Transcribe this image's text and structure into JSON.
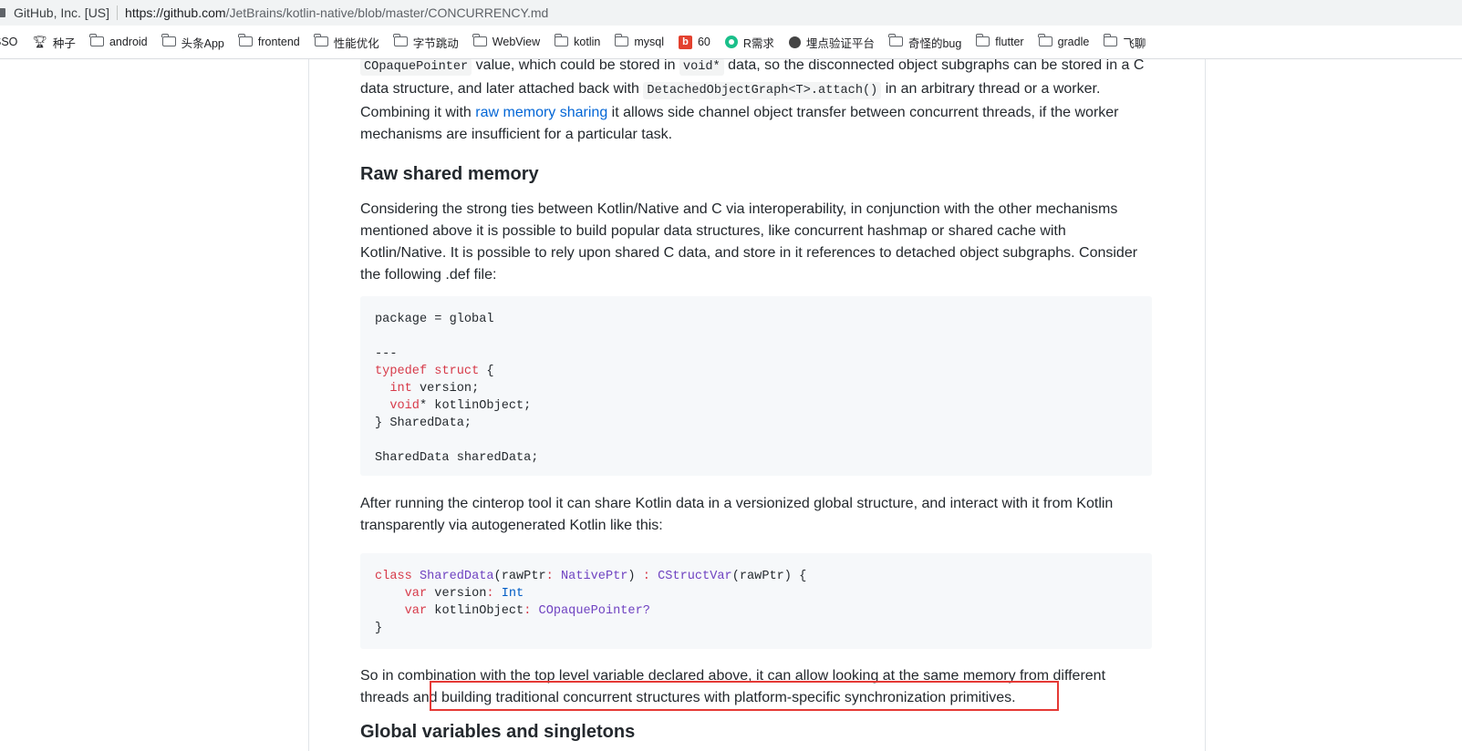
{
  "browser": {
    "site_label": "GitHub, Inc. [US]",
    "url_host": "https://github.com",
    "url_path": "/JetBrains/kotlin-native/blob/master/CONCURRENCY.md"
  },
  "bookmarks": [
    {
      "label": "SSO",
      "icon": "none"
    },
    {
      "label": "种子",
      "icon": "trophy-icon"
    },
    {
      "label": "android",
      "icon": "folder-icon"
    },
    {
      "label": "头条App",
      "icon": "folder-icon"
    },
    {
      "label": "frontend",
      "icon": "folder-icon"
    },
    {
      "label": "性能优化",
      "icon": "folder-icon"
    },
    {
      "label": "字节跳动",
      "icon": "folder-icon"
    },
    {
      "label": "WebView",
      "icon": "folder-icon"
    },
    {
      "label": "kotlin",
      "icon": "folder-icon"
    },
    {
      "label": "mysql",
      "icon": "folder-icon"
    },
    {
      "label": "60",
      "icon": "b-logo-icon"
    },
    {
      "label": "R需求",
      "icon": "green-circle-icon"
    },
    {
      "label": "埋点验证平台",
      "icon": "globe-icon"
    },
    {
      "label": "奇怪的bug",
      "icon": "folder-icon"
    },
    {
      "label": "flutter",
      "icon": "folder-icon"
    },
    {
      "label": "gradle",
      "icon": "folder-icon"
    },
    {
      "label": "飞聊",
      "icon": "folder-icon"
    }
  ],
  "article": {
    "p_intro": {
      "code1": "COpaquePointer",
      "t1": " value, which could be stored in ",
      "code2": "void*",
      "t2": " data, so the disconnected object subgraphs can be stored in a C data structure, and later attached back with ",
      "code3": "DetachedObjectGraph<T>.attach()",
      "t3": " in an arbitrary thread or a worker. Combining it with ",
      "link": "raw memory sharing",
      "t4": " it allows side channel object transfer between concurrent threads, if the worker mechanisms are insufficient for a particular task."
    },
    "heading_raw_shared_memory": "Raw shared memory",
    "p_considering": "Considering the strong ties between Kotlin/Native and C via interoperability, in conjunction with the other mechanisms mentioned above it is possible to build popular data structures, like concurrent hashmap or shared cache with Kotlin/Native. It is possible to rely upon shared C data, and store in it references to detached object subgraphs. Consider the following .def file:",
    "code_def": {
      "l1": "package = global",
      "l2": "---",
      "l3_kw1": "typedef",
      "l3_kw2": "struct",
      "l3_rest": " {",
      "l4_kw": "int",
      "l4_rest": " version;",
      "l5_kw": "void",
      "l5_rest": "* kotlinObject;",
      "l6": "} SharedData;",
      "l7": "SharedData sharedData;"
    },
    "p_after": "After running the cinterop tool it can share Kotlin data in a versionized global structure, and interact with it from Kotlin transparently via autogenerated Kotlin like this:",
    "code_kotlin": {
      "l1_kw": "class",
      "l1_name": "SharedData",
      "l1_param": "(rawPtr",
      "l1_colon": ":",
      "l1_type": "NativePtr",
      "l1_close": ")",
      "l1_colon2": ":",
      "l1_super": "CStructVar",
      "l1_rest": "(rawPtr) {",
      "l2_kw": "var",
      "l2_name": " version",
      "l2_colon": ":",
      "l2_type": "Int",
      "l3_kw": "var",
      "l3_name": " kotlinObject",
      "l3_colon": ":",
      "l3_type": "COpaquePointer?",
      "l4": "}"
    },
    "p_so": "So in combination with the top level variable declared above, it can allow looking at the same memory from different threads and building traditional concurrent structures with platform-specific synchronization primitives.",
    "heading_next_partial": "Global variables and singletons"
  },
  "colors": {
    "highlight": "#e53935",
    "link": "#0366d6",
    "keyword": "#d73a49",
    "type": "#6f42c1"
  }
}
